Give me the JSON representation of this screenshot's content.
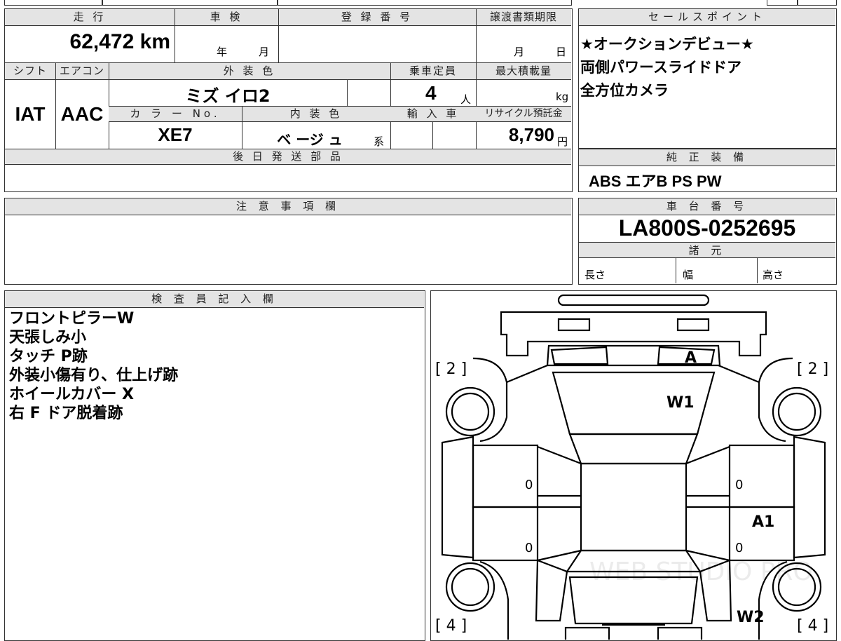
{
  "vehicle_info": {
    "mileage_label": "走 行",
    "mileage_value": "62,472 km",
    "inspection_label": "車 検",
    "inspection_year": "年",
    "inspection_month": "月",
    "registration_label": "登 録 番 号",
    "transfer_deadline_label": "譲渡書類期限",
    "transfer_month": "月",
    "transfer_day": "日",
    "shift_label": "シフト",
    "shift_value": "IAT",
    "aircon_label": "エアコン",
    "aircon_value": "AAC",
    "exterior_color_label": "外 装 色",
    "exterior_color_value": "ミズ イロ2",
    "capacity_label": "乗車定員",
    "capacity_value": "4",
    "capacity_unit": "人",
    "max_load_label": "最大積載量",
    "max_load_unit": "kg",
    "color_no_label": "カ ラ ー No.",
    "color_no_value": "XE7",
    "interior_color_label": "内 装 色",
    "interior_color_value": "ベ ージ ュ",
    "interior_suffix": "系",
    "import_label": "輸 入 車",
    "recycle_label": "リサイクル預託金",
    "recycle_value": "8,790",
    "recycle_unit": "円",
    "later_parts_label": "後 日 発 送 部 品"
  },
  "sales_points": {
    "title": "セールスポイント",
    "lines": [
      "★オークションデビュー★",
      "両側パワースライドドア",
      "全方位カメラ"
    ]
  },
  "standard_equipment": {
    "title": "純 正 装 備",
    "value": "ABS エアB PS PW"
  },
  "notes": {
    "title": "注 意 事 項 欄"
  },
  "chassis": {
    "title": "車 台 番 号",
    "value": "LA800S-0252695",
    "specs_title": "諸 元",
    "length_label": "長さ",
    "width_label": "幅",
    "height_label": "高さ"
  },
  "inspector": {
    "title": "検 査 員 記 入 欄",
    "lines": [
      "フロントピラーW",
      "天張しみ小",
      "タッチ P跡",
      "外装小傷有り、仕上げ跡",
      "ホイールカバー X",
      "右 F ドア脱着跡"
    ]
  },
  "diagram": {
    "tire_front_left": "[ 2 ]",
    "tire_front_right": "[ 2 ]",
    "tire_rear_left": "[ 4 ]",
    "tire_rear_right": "[ 4 ]",
    "mark_windshield_top": "A",
    "mark_windshield": "W1",
    "mark_right_side": "A1",
    "mark_rear_glass": "W2",
    "zero_1": "0",
    "zero_2": "0",
    "zero_3": "0",
    "zero_4": "0",
    "watermark": "WEB STUDIO PRO"
  }
}
